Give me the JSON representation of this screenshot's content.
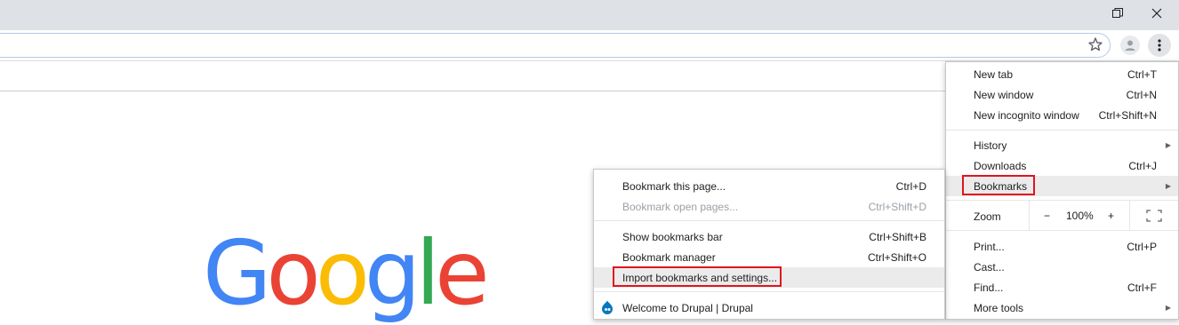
{
  "window": {
    "restore_glyph": "❐",
    "close_glyph": "✕"
  },
  "toolbar": {
    "star_icon": "star-icon",
    "profile_icon": "person-icon",
    "menu_icon": "vertical-dots-icon"
  },
  "logo": {
    "letters": [
      "G",
      "o",
      "o",
      "g",
      "l",
      "e"
    ],
    "colors": [
      "#4285F4",
      "#EA4335",
      "#FBBC05",
      "#4285F4",
      "#34A853",
      "#EA4335"
    ]
  },
  "main_menu": {
    "new_tab": {
      "label": "New tab",
      "shortcut": "Ctrl+T"
    },
    "new_window": {
      "label": "New window",
      "shortcut": "Ctrl+N"
    },
    "new_incognito": {
      "label": "New incognito window",
      "shortcut": "Ctrl+Shift+N"
    },
    "history": {
      "label": "History"
    },
    "downloads": {
      "label": "Downloads",
      "shortcut": "Ctrl+J"
    },
    "bookmarks": {
      "label": "Bookmarks"
    },
    "zoom": {
      "label": "Zoom",
      "minus": "−",
      "value": "100%",
      "plus": "+"
    },
    "print": {
      "label": "Print...",
      "shortcut": "Ctrl+P"
    },
    "cast": {
      "label": "Cast..."
    },
    "find": {
      "label": "Find...",
      "shortcut": "Ctrl+F"
    },
    "more_tools": {
      "label": "More tools"
    }
  },
  "bookmarks_submenu": {
    "bookmark_page": {
      "label": "Bookmark this page...",
      "shortcut": "Ctrl+D"
    },
    "bookmark_open": {
      "label": "Bookmark open pages...",
      "shortcut": "Ctrl+Shift+D"
    },
    "show_bar": {
      "label": "Show bookmarks bar",
      "shortcut": "Ctrl+Shift+B"
    },
    "manager": {
      "label": "Bookmark manager",
      "shortcut": "Ctrl+Shift+O"
    },
    "import": {
      "label": "Import bookmarks and settings..."
    },
    "drupal": {
      "label": "Welcome to Drupal | Drupal"
    }
  },
  "highlight_color": "#e0141e"
}
